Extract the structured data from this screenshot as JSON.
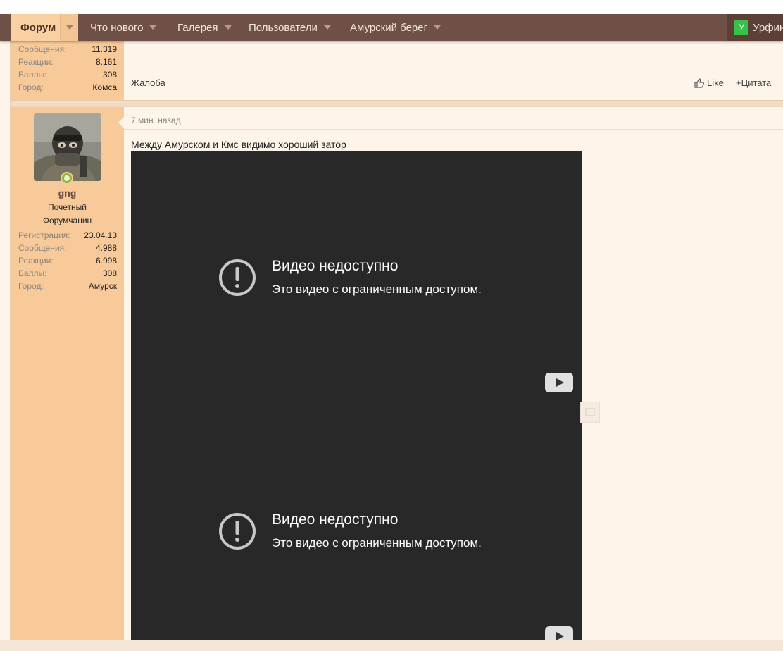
{
  "nav": {
    "tabs": [
      {
        "label": "Форум",
        "active": true
      },
      {
        "label": "Что нового"
      },
      {
        "label": "Галерея"
      },
      {
        "label": "Пользователи"
      },
      {
        "label": "Амурский берег"
      }
    ],
    "user": {
      "initial": "У",
      "name": "Урфин"
    }
  },
  "prev_post": {
    "stats": [
      {
        "key": "Сообщения:",
        "value": "11.319"
      },
      {
        "key": "Реакции:",
        "value": "8.161"
      },
      {
        "key": "Баллы:",
        "value": "308"
      },
      {
        "key": "Город:",
        "value": "Комса"
      }
    ],
    "complaint": "Жалоба",
    "like": "Like",
    "quote": "+Цитата"
  },
  "post": {
    "author": {
      "name": "gng",
      "title_line1": "Почетный",
      "title_line2": "Форумчанин",
      "stats": [
        {
          "key": "Регистрация:",
          "value": "23.04.13"
        },
        {
          "key": "Сообщения:",
          "value": "4.988"
        },
        {
          "key": "Реакции:",
          "value": "6.998"
        },
        {
          "key": "Баллы:",
          "value": "308"
        },
        {
          "key": "Город:",
          "value": "Амурск"
        }
      ]
    },
    "time": "7 мин. назад",
    "text": "Между Амурском и Кмс видимо хороший затор",
    "videos": [
      {
        "title": "Видео недоступно",
        "subtitle": "Это видео с ограниченным доступом."
      },
      {
        "title": "Видео недоступно",
        "subtitle": "Это видео с ограниченным доступом."
      }
    ]
  },
  "colors": {
    "navbar": "#6e5046",
    "sidebar": "#f8ca9a",
    "post_bg": "#fdf4ea",
    "video_bg": "#282828"
  }
}
